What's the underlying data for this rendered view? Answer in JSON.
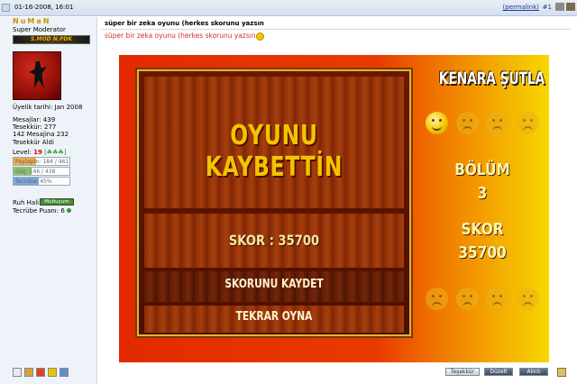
{
  "post": {
    "date": "01-16-2008, 16:01",
    "permalink": "(permalink)",
    "number": "#1",
    "title": "süper bir zeka oyunu (herkes skorunu yazsın",
    "message": "süper bir zeka oyunu (herkes skorunu yazsın"
  },
  "user": {
    "name": "NuMaN",
    "title": "Super Moderator",
    "rank_text": "S.MOD N.PDK",
    "join": "Üyelik tarihi: Jan 2008",
    "posts": "Mesajlar: 439",
    "thanks": "Tesekkür: 277",
    "thanked": "142 Mesajina 232 Tesekkür Aldi",
    "level_label": "Level:",
    "level_value": "19",
    "level_stars": "[☘☘☘]",
    "bars": [
      {
        "label": "Paylaşım: 184 / 461",
        "fraction": 0.4,
        "color": "#f2a94a"
      },
      {
        "label": "Güç: 146 / 438",
        "fraction": 0.33,
        "color": "#8ac46a"
      },
      {
        "label": "Tecrübe: 45%",
        "fraction": 0.45,
        "color": "#7aa8e0"
      }
    ],
    "ruh_label": "Ruh Hali:",
    "ruh_value": "Mutluyum",
    "tecrube_puani": "Tecrübe Puanı: 6"
  },
  "game": {
    "headline": "OYUNU KAYBETTİN",
    "score_line": "SKOR : 35700",
    "save": "SKORUNU KAYDET",
    "retry": "TEKRAR OYNA",
    "brand": "KENARA ŞUTLA",
    "level_title": "BÖLÜM",
    "level_value": "3",
    "score_title": "SKOR",
    "score_value": "35700"
  },
  "buttons": {
    "thanks": "Teşekkür",
    "edit": "Düzelt",
    "quote": "Alıntı"
  },
  "colors": {
    "accent": "#d2321e",
    "username": "#c99300",
    "game_gold": "#f2c400"
  }
}
